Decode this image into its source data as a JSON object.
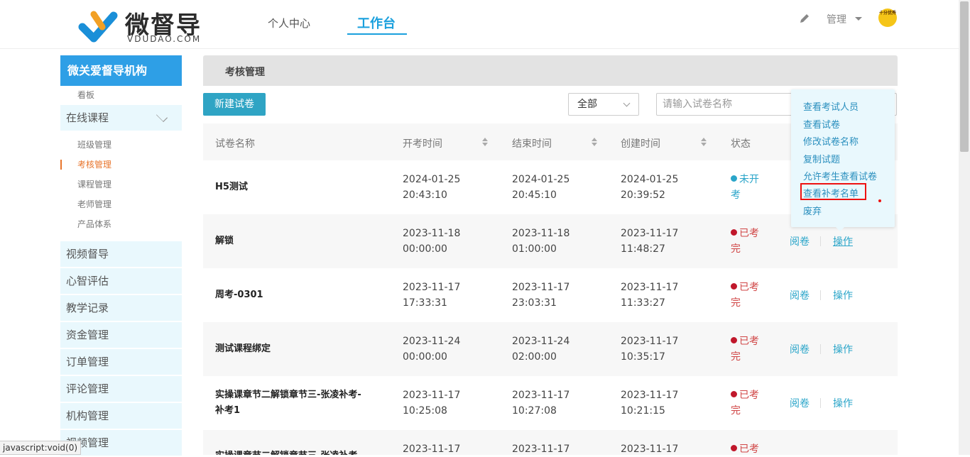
{
  "header": {
    "logo_text": "微督导",
    "logo_sub": "VDUDAO.COM",
    "nav_personal": "个人中心",
    "nav_work": "工作台",
    "admin_label": "管理",
    "avatar_text": "十分优秀"
  },
  "sidebar": {
    "org": "微关爱督导机构",
    "top_sub": "看板",
    "online_course": "在线课程",
    "sub_items": [
      "班级管理",
      "考核管理",
      "课程管理",
      "老师管理",
      "产品体系"
    ],
    "groups": [
      "视频督导",
      "心智评估",
      "教学记录",
      "资金管理",
      "订单管理",
      "评论管理",
      "机构管理",
      "视频管理"
    ]
  },
  "main": {
    "breadcrumb": "考核管理",
    "new_button": "新建试卷",
    "filter_value": "全部",
    "search_placeholder": "请输入试卷名称",
    "columns": [
      "试卷名称",
      "开考时间",
      "结束时间",
      "创建时间",
      "状态"
    ],
    "rows": [
      {
        "name": "H5测试",
        "start_d": "2024-01-25",
        "start_t": "20:43:10",
        "end_d": "2024-01-25",
        "end_t": "20:45:10",
        "create_d": "2024-01-25",
        "create_t": "20:39:52",
        "status1": "未开",
        "status2": "考"
      },
      {
        "name": "解锁",
        "start_d": "2023-11-18",
        "start_t": "00:00:00",
        "end_d": "2023-11-18",
        "end_t": "01:00:00",
        "create_d": "2023-11-17",
        "create_t": "11:48:27",
        "status1": "已考",
        "status2": "完"
      },
      {
        "name": "周考-0301",
        "start_d": "2023-11-17",
        "start_t": "17:33:31",
        "end_d": "2023-11-17",
        "end_t": "23:03:31",
        "create_d": "2023-11-17",
        "create_t": "11:33:27",
        "status1": "已考",
        "status2": "完"
      },
      {
        "name": "测试课程绑定",
        "start_d": "2023-11-24",
        "start_t": "00:00:00",
        "end_d": "2023-11-24",
        "end_t": "02:00:00",
        "create_d": "2023-11-17",
        "create_t": "10:35:17",
        "status1": "已考",
        "status2": "完"
      },
      {
        "name": "实操课章节二解锁章节三-张凌补考-",
        "name2": "补考1",
        "start_d": "2023-11-17",
        "start_t": "10:25:08",
        "end_d": "2023-11-17",
        "end_t": "10:27:08",
        "create_d": "2023-11-17",
        "create_t": "10:21:15",
        "status1": "已考",
        "status2": "完"
      },
      {
        "name": "实操课章节二解锁章节三-张凌补考-",
        "start_d": "2023-11-17",
        "start_t": "",
        "end_d": "2023-11-17",
        "end_t": "",
        "create_d": "2023-11-17",
        "create_t": "",
        "status1": "已考",
        "status2": ""
      }
    ],
    "action_read": "阅卷",
    "action_op": "操作"
  },
  "popover": {
    "items": [
      "查看考试人员",
      "查看试卷",
      "修改试卷名称",
      "复制试题",
      "允许考生查看试卷",
      "查看补考名单",
      "废弃"
    ]
  },
  "statusbar": "javascript:void(0)",
  "colors": {
    "primary": "#2e9fe6",
    "teal": "#2fa4c4",
    "status_red": "#d04545",
    "status_blue": "#2aa5c9",
    "active_orange": "#e8752c"
  }
}
